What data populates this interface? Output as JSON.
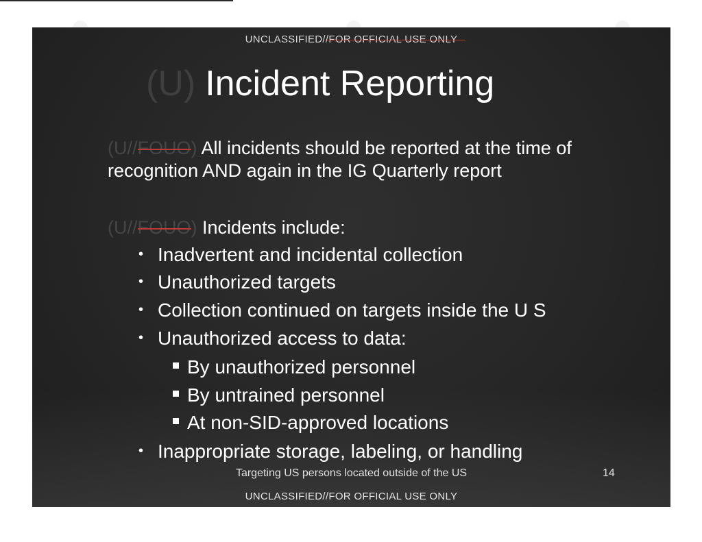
{
  "header": {
    "banner_prefix": "UNCLASSIFIED//",
    "banner_struck": "FOR OFFICIAL USE ONLY"
  },
  "slide": {
    "title_marking": "(U)",
    "title": "Incident Reporting",
    "para1": {
      "marking_open": "(U//",
      "marking_fouo": "FOUO",
      "marking_close": ")",
      "text": "All incidents should be reported at the time of recognition AND again in the IG Quarterly report"
    },
    "para2": {
      "marking_open": "(U//",
      "marking_fouo": "FOUO",
      "marking_close": ")",
      "text": "Incidents include:"
    },
    "bullets": [
      {
        "text": "Inadvertent and incidental collection"
      },
      {
        "text": "Unauthorized targets"
      },
      {
        "text": "Collection continued on targets inside the U S"
      },
      {
        "text": "Unauthorized access to data:"
      }
    ],
    "sub_bullets": [
      {
        "text": "By unauthorized personnel"
      },
      {
        "text": "By untrained personnel"
      },
      {
        "text": "At non-SID-approved locations"
      }
    ],
    "last_bullet": {
      "text": "Inappropriate storage, labeling, or handling"
    },
    "footer_note": "Targeting US persons located outside of the US",
    "page_number": "14"
  },
  "footer": {
    "banner": "UNCLASSIFIED//FOR OFFICIAL USE ONLY"
  },
  "colors": {
    "slide_background": "#262626",
    "text": "#ffffff",
    "marking": "#464646",
    "strike": "#b83a32"
  }
}
